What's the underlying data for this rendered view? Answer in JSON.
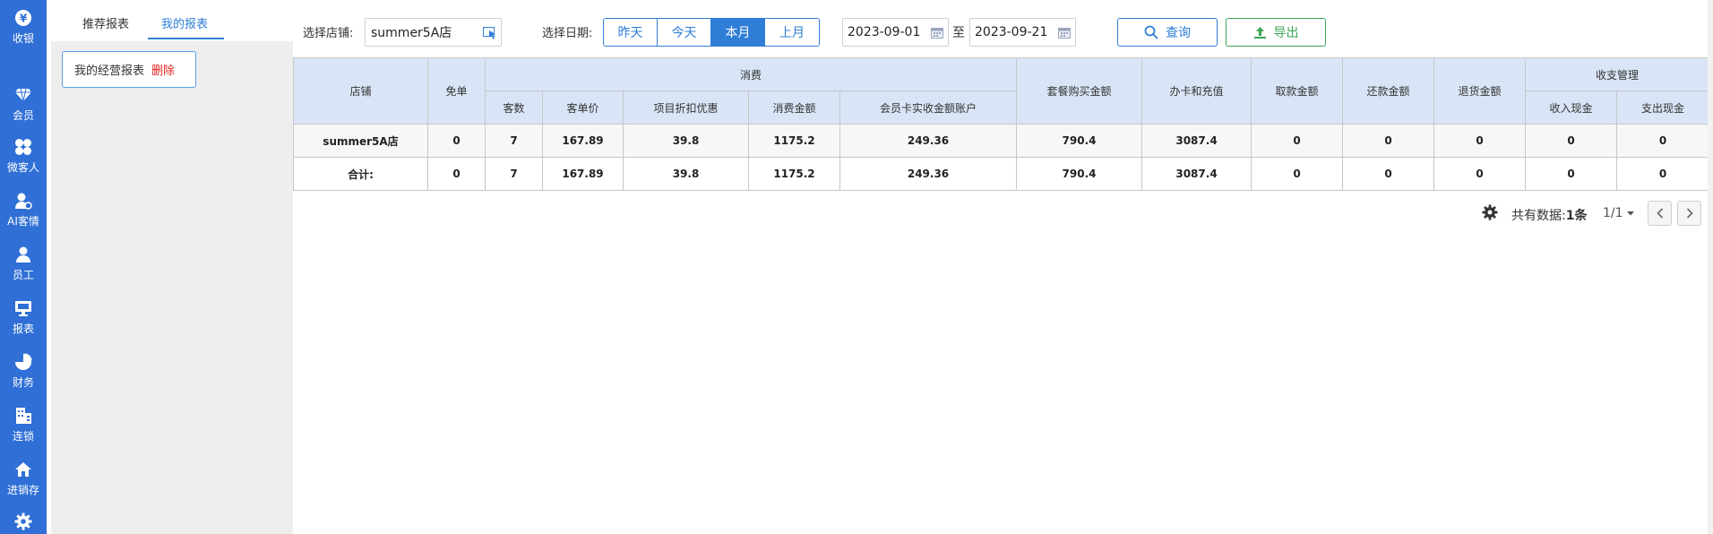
{
  "nav": [
    {
      "icon": "yen-icon",
      "label": "收银"
    },
    {
      "icon": "diamond-icon",
      "label": "会员"
    },
    {
      "icon": "grid-icon",
      "label": "微客人"
    },
    {
      "icon": "ai-user-icon",
      "label": "AI客情"
    },
    {
      "icon": "person-icon",
      "label": "员工"
    },
    {
      "icon": "monitor-icon",
      "label": "报表"
    },
    {
      "icon": "pie-icon",
      "label": "财务"
    },
    {
      "icon": "building-icon",
      "label": "连锁"
    },
    {
      "icon": "home-icon",
      "label": "进销存"
    },
    {
      "icon": "gear-icon",
      "label": ""
    }
  ],
  "panel": {
    "tabs": [
      "推荐报表",
      "我的报表"
    ],
    "active_tab": 1,
    "report_name": "我的经营报表",
    "delete_label": "删除"
  },
  "filters": {
    "store_label": "选择店铺:",
    "store_value": "summer5A店",
    "date_label": "选择日期:",
    "quick_dates": [
      "昨天",
      "今天",
      "本月",
      "上月"
    ],
    "active_quick_date": "本月",
    "start_date": "2023-09-01",
    "to_label": "至",
    "end_date": "2023-09-21",
    "query_label": "查询",
    "export_label": "导出"
  },
  "table": {
    "headers": {
      "store": "店铺",
      "free": "免单",
      "consume_group": "消费",
      "consume_cols": [
        "客数",
        "客单价",
        "项目折扣优惠",
        "消费金额",
        "会员卡实收金额账户"
      ],
      "package": "套餐购买金额",
      "card_recharge": "办卡和充值",
      "withdraw": "取款金额",
      "repay": "还款金额",
      "refund": "退货金额",
      "cash_group": "收支管理",
      "cash_cols": [
        "收入现金",
        "支出现金"
      ]
    },
    "rows": [
      [
        "summer5A店",
        "0",
        "7",
        "167.89",
        "39.8",
        "1175.2",
        "249.36",
        "790.4",
        "3087.4",
        "0",
        "0",
        "0",
        "0",
        "0"
      ],
      [
        "合计:",
        "0",
        "7",
        "167.89",
        "39.8",
        "1175.2",
        "249.36",
        "790.4",
        "3087.4",
        "0",
        "0",
        "0",
        "0",
        "0"
      ]
    ]
  },
  "pager": {
    "total_label": "共有数据:",
    "total_count": "1条",
    "page_info": "1/1"
  },
  "colors": {
    "nav_bg": "#2f6fd6",
    "accent": "#2f7ed8",
    "export": "#3aa655",
    "delete": "#e02020",
    "header_bg": "#d9e5f6"
  }
}
